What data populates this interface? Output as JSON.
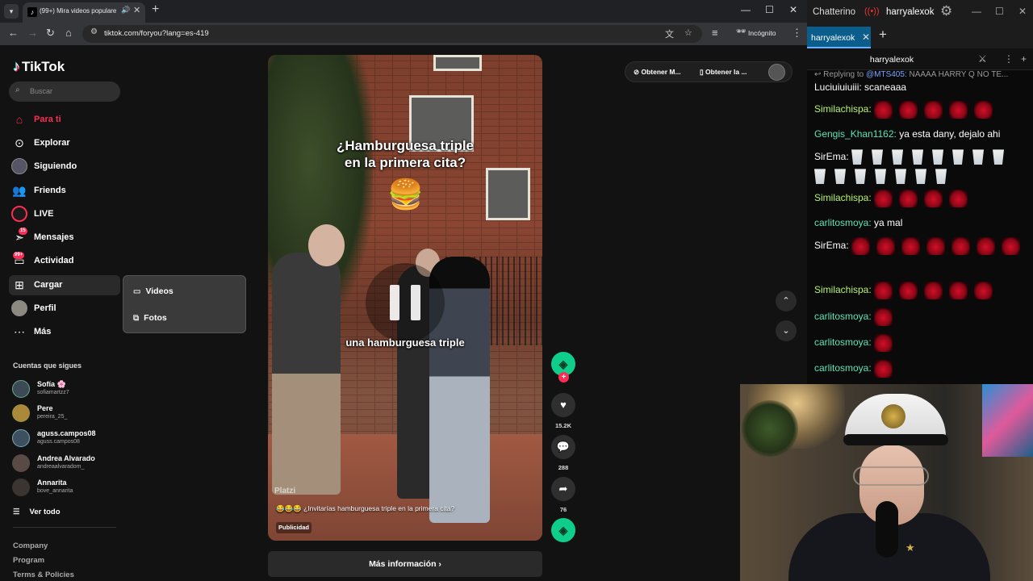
{
  "browser": {
    "tab_title": "(99+) Mira videos populares",
    "tab_favicon": "tiktok-icon",
    "url": "tiktok.com/foryou?lang=es-419",
    "incognito_label": "Incógnito"
  },
  "sidebar": {
    "logo": "TikTok",
    "search_placeholder": "Buscar",
    "nav": [
      {
        "label": "Para ti",
        "icon": "home-icon"
      },
      {
        "label": "Explorar",
        "icon": "compass-icon"
      },
      {
        "label": "Siguiendo",
        "icon": "avatar-icon"
      },
      {
        "label": "Friends",
        "icon": "friends-icon"
      },
      {
        "label": "LIVE",
        "icon": "live-icon"
      },
      {
        "label": "Mensajes",
        "icon": "send-icon",
        "badge": "15"
      },
      {
        "label": "Actividad",
        "icon": "inbox-icon",
        "badge": "99+"
      },
      {
        "label": "Cargar",
        "icon": "upload-icon"
      },
      {
        "label": "Perfil",
        "icon": "profile-icon"
      },
      {
        "label": "Más",
        "icon": "more-icon"
      }
    ],
    "upload_menu": {
      "videos": "Videos",
      "photos": "Fotos"
    },
    "following_title": "Cuentas que sigues",
    "accounts": [
      {
        "name": "Sofía 🌸",
        "username": "sofiamartzz7"
      },
      {
        "name": "Pere",
        "username": "pereira_25_"
      },
      {
        "name": "aguss.campos08",
        "username": "aguss.campos08"
      },
      {
        "name": "Andrea Alvarado",
        "username": "andreaalvaradom_"
      },
      {
        "name": "Annarita",
        "username": "bove_annarita"
      }
    ],
    "see_all": "Ver todo",
    "footer": [
      "Company",
      "Program",
      "Terms & Policies"
    ]
  },
  "video": {
    "title_line1": "¿Hamburguesa triple",
    "title_line2": "en la primera cita?",
    "caption": "una hamburguesa triple",
    "watermark": "Platzi",
    "description": "😂😂😂 ¿Invitarías hamburguesa triple en la primera cita?",
    "ad_label": "Publicidad",
    "more_info": "Más información"
  },
  "actions": {
    "likes": "15.2K",
    "comments": "288",
    "shares": "76"
  },
  "top_pills": {
    "get_coins": "Obtener M...",
    "get_app": "Obtener la ..."
  },
  "chatterino": {
    "app_name": "Chatterino",
    "channel": "harryalexok",
    "tab_label": "harryalexok",
    "split_name": "harryalexok",
    "reply_prefix": "Replying to",
    "reply_user": "@MTS405:",
    "reply_text": "NAAAA HARRY Q NO TE...",
    "messages": [
      {
        "user": "Luciuiuiuiii:",
        "color": "#ffffff",
        "text": "scaneaaa"
      },
      {
        "user": "Similachispa:",
        "color": "#b6f36b",
        "text": ""
      },
      {
        "user": "Gengis_Khan1162:",
        "color": "#5fe3b5",
        "text": "ya esta dany, dejalo ahi"
      },
      {
        "user": "SirEma:",
        "color": "#ffffff",
        "text": ""
      },
      {
        "user": "Similachispa:",
        "color": "#b6f36b",
        "text": ""
      },
      {
        "user": "carlitosmoya:",
        "color": "#5fe3b5",
        "text": "ya mal"
      },
      {
        "user": "SirEma:",
        "color": "#ffffff",
        "text": ""
      },
      {
        "user": "Similachispa:",
        "color": "#b6f36b",
        "text": ""
      },
      {
        "user": "carlitosmoya:",
        "color": "#5fe3b5",
        "text": ""
      },
      {
        "user": "carlitosmoya:",
        "color": "#5fe3b5",
        "text": ""
      },
      {
        "user": "carlitosmoya:",
        "color": "#5fe3b5",
        "text": ""
      }
    ]
  },
  "colors": {
    "tiktok_red": "#fe2c55",
    "platzi_green": "#0fce8c",
    "chat_tab_blue": "#0b5d8c"
  }
}
